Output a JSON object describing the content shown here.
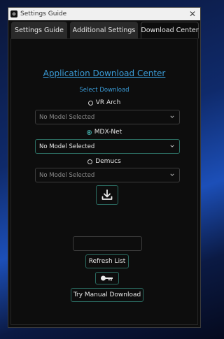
{
  "window": {
    "title": "Settings Guide",
    "close_glyph": "✕"
  },
  "tabs": [
    {
      "label": "Settings Guide"
    },
    {
      "label": "Additional Settings"
    },
    {
      "label": "Download Center",
      "selected": true
    }
  ],
  "main": {
    "heading": "Application Download Center",
    "select_label": "Select Download",
    "options": [
      {
        "label": "VR Arch",
        "selected": false,
        "dropdown_value": "No Model Selected"
      },
      {
        "label": "MDX-Net",
        "selected": true,
        "dropdown_value": "No Model Selected"
      },
      {
        "label": "Demucs",
        "selected": false,
        "dropdown_value": "No Model Selected"
      }
    ],
    "download_icon": "download-icon",
    "refresh_label": "Refresh List",
    "key_icon": "key-icon",
    "manual_label": "Try Manual Download"
  },
  "colors": {
    "accent": "#3a9bd6",
    "border_accent": "#2a6a60",
    "background": "#0d0d0d"
  }
}
